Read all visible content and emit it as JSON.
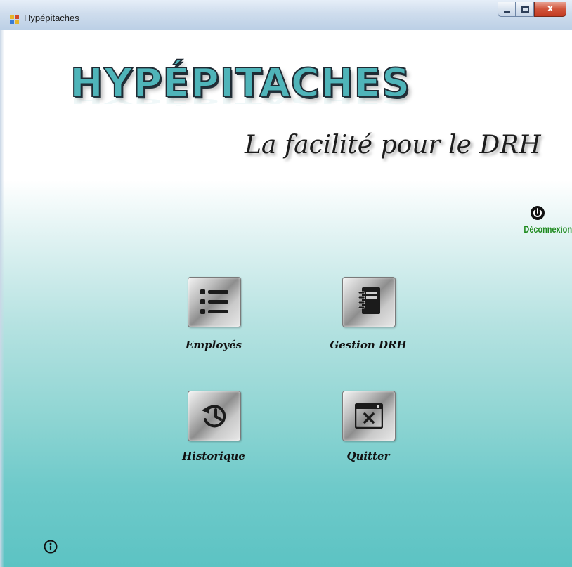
{
  "window": {
    "title": "Hypépitaches",
    "close_glyph": "x"
  },
  "banner": {
    "logo_title": "HYPÉPITACHES",
    "tagline": "La facilité pour le DRH"
  },
  "logout": {
    "label": "Déconnexion",
    "icon": "power-icon",
    "color": "#1e8a1e"
  },
  "menu": {
    "employees": {
      "label": "Employés",
      "icon": "list-icon"
    },
    "gestion_drh": {
      "label": "Gestion DRH",
      "icon": "notebook-icon"
    },
    "history": {
      "label": "Historique",
      "icon": "history-icon"
    },
    "quit": {
      "label": "Quitter",
      "icon": "window-close-icon"
    }
  },
  "footer": {
    "icon": "info-icon"
  },
  "colors": {
    "logo_fill": "#4fb4b9",
    "background_bottom": "#5cc3c3",
    "titlebar": "#cfdded"
  }
}
